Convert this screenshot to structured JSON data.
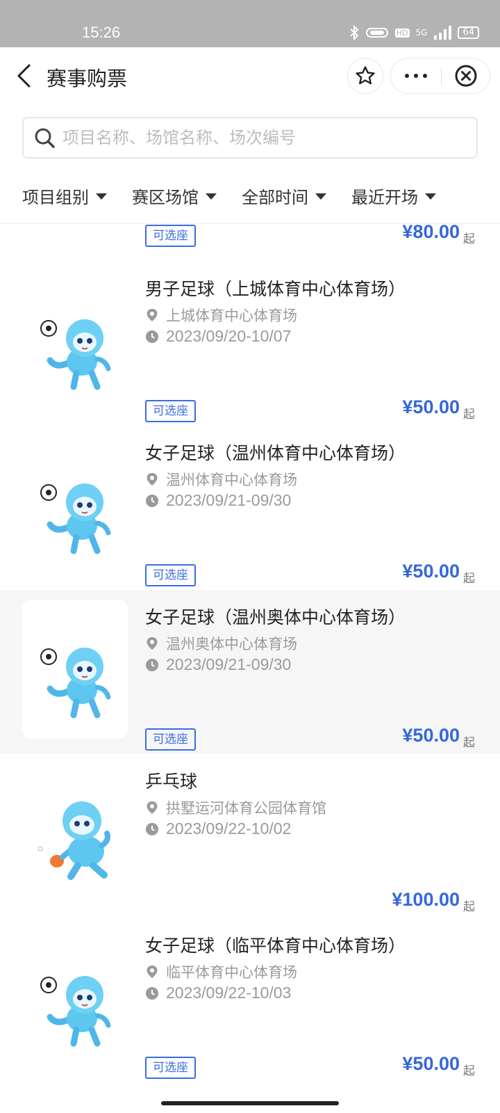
{
  "status_bar": {
    "time": "15:26",
    "network": "5G",
    "hd": "HD",
    "battery": "64"
  },
  "nav": {
    "title": "赛事购票",
    "back_icon": "chevron-left-icon",
    "favorite_icon": "star-icon",
    "more_icon": "ellipsis-icon",
    "close_icon": "close-circle-icon"
  },
  "search": {
    "placeholder": "项目名称、场馆名称、场次编号",
    "value": ""
  },
  "filters": [
    {
      "label": "项目组别"
    },
    {
      "label": "赛区场馆"
    },
    {
      "label": "全部时间"
    },
    {
      "label": "最近开场"
    }
  ],
  "events": [
    {
      "name": "",
      "venue": "",
      "date": "",
      "tag": "可选座",
      "price": "¥80.00",
      "price_suffix": "起"
    },
    {
      "name": "男子足球（上城体育中心体育场）",
      "venue": "上城体育中心体育场",
      "date": "2023/09/20-10/07",
      "tag": "可选座",
      "price": "¥50.00",
      "price_suffix": "起"
    },
    {
      "name": "女子足球（温州体育中心体育场）",
      "venue": "温州体育中心体育场",
      "date": "2023/09/21-09/30",
      "tag": "可选座",
      "price": "¥50.00",
      "price_suffix": "起"
    },
    {
      "name": "女子足球（温州奥体中心体育场）",
      "venue": "温州奥体中心体育场",
      "date": "2023/09/21-09/30",
      "tag": "可选座",
      "price": "¥50.00",
      "price_suffix": "起"
    },
    {
      "name": "乒乓球",
      "venue": "拱墅运河体育公园体育馆",
      "date": "2023/09/22-10/02",
      "tag": "",
      "price": "¥100.00",
      "price_suffix": "起"
    },
    {
      "name": "女子足球（临平体育中心体育场）",
      "venue": "临平体育中心体育场",
      "date": "2023/09/22-10/03",
      "tag": "可选座",
      "price": "¥50.00",
      "price_suffix": "起"
    }
  ],
  "colors": {
    "accent": "#3467dc",
    "status_bar": "#b3b3b3",
    "active_row": "#f6f6f6",
    "mascot": "#5ec7f0"
  }
}
